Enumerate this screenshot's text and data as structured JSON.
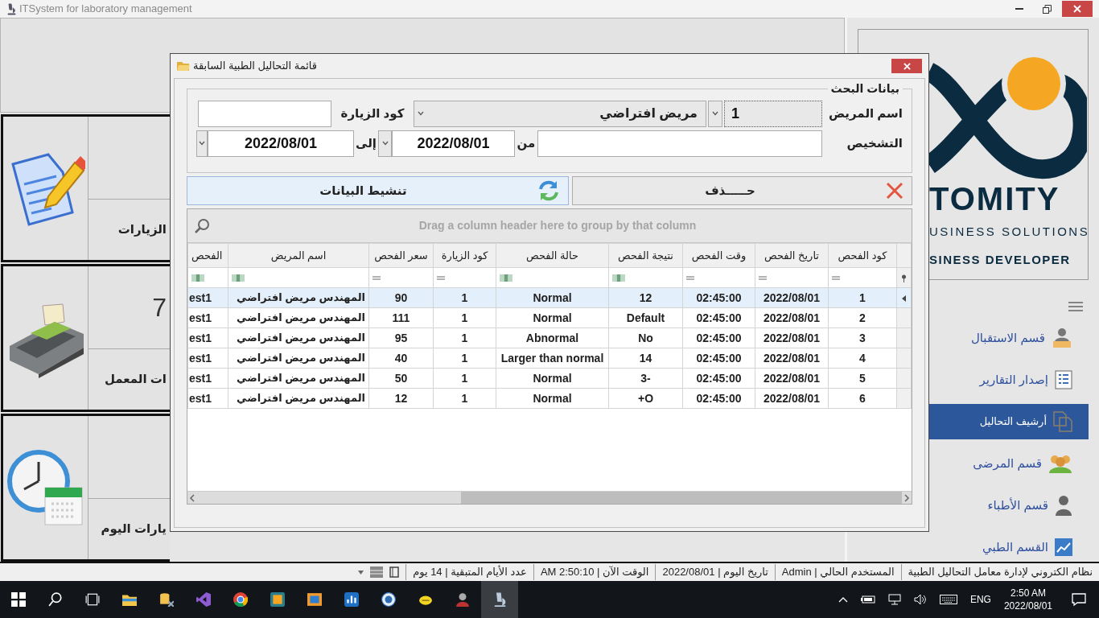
{
  "main_window": {
    "title": "ITSystem for laboratory management"
  },
  "tiles": [
    {
      "caption": "الزيارات"
    },
    {
      "value": "7",
      "caption": "ات المعمل"
    },
    {
      "caption": "يارات اليوم"
    }
  ],
  "logo": {
    "lines": [
      "TOMITY",
      "USINESS SOLUTIONS",
      "SINESS DEVELOPER"
    ]
  },
  "sidebar": {
    "items": [
      {
        "label": "قسم الاستقبال",
        "selected": false
      },
      {
        "label": "إصدار التقارير",
        "selected": false
      },
      {
        "label": "أرشيف التحاليل",
        "selected": true
      },
      {
        "label": "قسم المرضى",
        "selected": false
      },
      {
        "label": "قسم الأطباء",
        "selected": false
      },
      {
        "label": "القسم الطبي",
        "selected": false
      }
    ]
  },
  "dialog": {
    "title": "قائمة التحاليل الطبية السابقة",
    "search_group": {
      "title": "بيانات البحث",
      "patient_label": "اسم المريض",
      "patient_code": "1",
      "patient_name": "مريض افتراضي",
      "visit_code_label": "كود الزيارة",
      "diagnosis_label": "التشخيص",
      "from_label": "من",
      "from_date": "2022/08/01",
      "to_label": "إلى",
      "to_date": "2022/08/01"
    },
    "buttons": [
      {
        "kind": "delete",
        "label": "حـــــذف"
      },
      {
        "kind": "refresh",
        "label": "تنشيط البيانات"
      }
    ],
    "grid": {
      "group_panel_hint": "Drag a column header here to group by that column",
      "columns": [
        {
          "label": "كود الفحص",
          "kind": "number"
        },
        {
          "label": "تاريخ الفحص",
          "kind": "number"
        },
        {
          "label": "وقت الفحص",
          "kind": "number"
        },
        {
          "label": "نتيجة الفحص",
          "kind": "text"
        },
        {
          "label": "حالة الفحص",
          "kind": "text"
        },
        {
          "label": "كود الزيارة",
          "kind": "number"
        },
        {
          "label": "سعر الفحص",
          "kind": "number"
        },
        {
          "label": "اسم المريض",
          "kind": "text"
        },
        {
          "label": "الفحص",
          "kind": "text"
        }
      ],
      "rows": [
        {
          "selected": true,
          "cells": [
            "1",
            "2022/08/01",
            "02:45:00",
            "12",
            "Normal",
            "1",
            "90",
            "المهندس مريض افتراضي",
            "est1"
          ]
        },
        {
          "selected": false,
          "cells": [
            "2",
            "2022/08/01",
            "02:45:00",
            "Default",
            "Normal",
            "1",
            "111",
            "المهندس مريض افتراضي",
            "est1"
          ]
        },
        {
          "selected": false,
          "cells": [
            "3",
            "2022/08/01",
            "02:45:00",
            "No",
            "Abnormal",
            "1",
            "95",
            "المهندس مريض افتراضي",
            "est1"
          ]
        },
        {
          "selected": false,
          "cells": [
            "4",
            "2022/08/01",
            "02:45:00",
            "14",
            "Larger than normal",
            "1",
            "40",
            "المهندس مريض افتراضي",
            "est1"
          ]
        },
        {
          "selected": false,
          "cells": [
            "5",
            "2022/08/01",
            "02:45:00",
            "-3",
            "Normal",
            "1",
            "50",
            "المهندس مريض افتراضي",
            "est1"
          ]
        },
        {
          "selected": false,
          "cells": [
            "6",
            "2022/08/01",
            "02:45:00",
            "O+",
            "Normal",
            "1",
            "12",
            "المهندس مريض افتراضي",
            "est1"
          ]
        }
      ]
    }
  },
  "status_bar": {
    "items": [
      "نظام الكتروني لإدارة معامل التحاليل الطبية",
      "المستخدم الحالي | Admin",
      "تاريخ اليوم | 2022/08/01",
      "الوقت الآن | 2:50:10 AM",
      "عدد الأيام المتبقية | 14 يوم"
    ]
  },
  "taskbar": {
    "language": "ENG",
    "time": "2:50 AM",
    "date": "2022/08/01"
  }
}
